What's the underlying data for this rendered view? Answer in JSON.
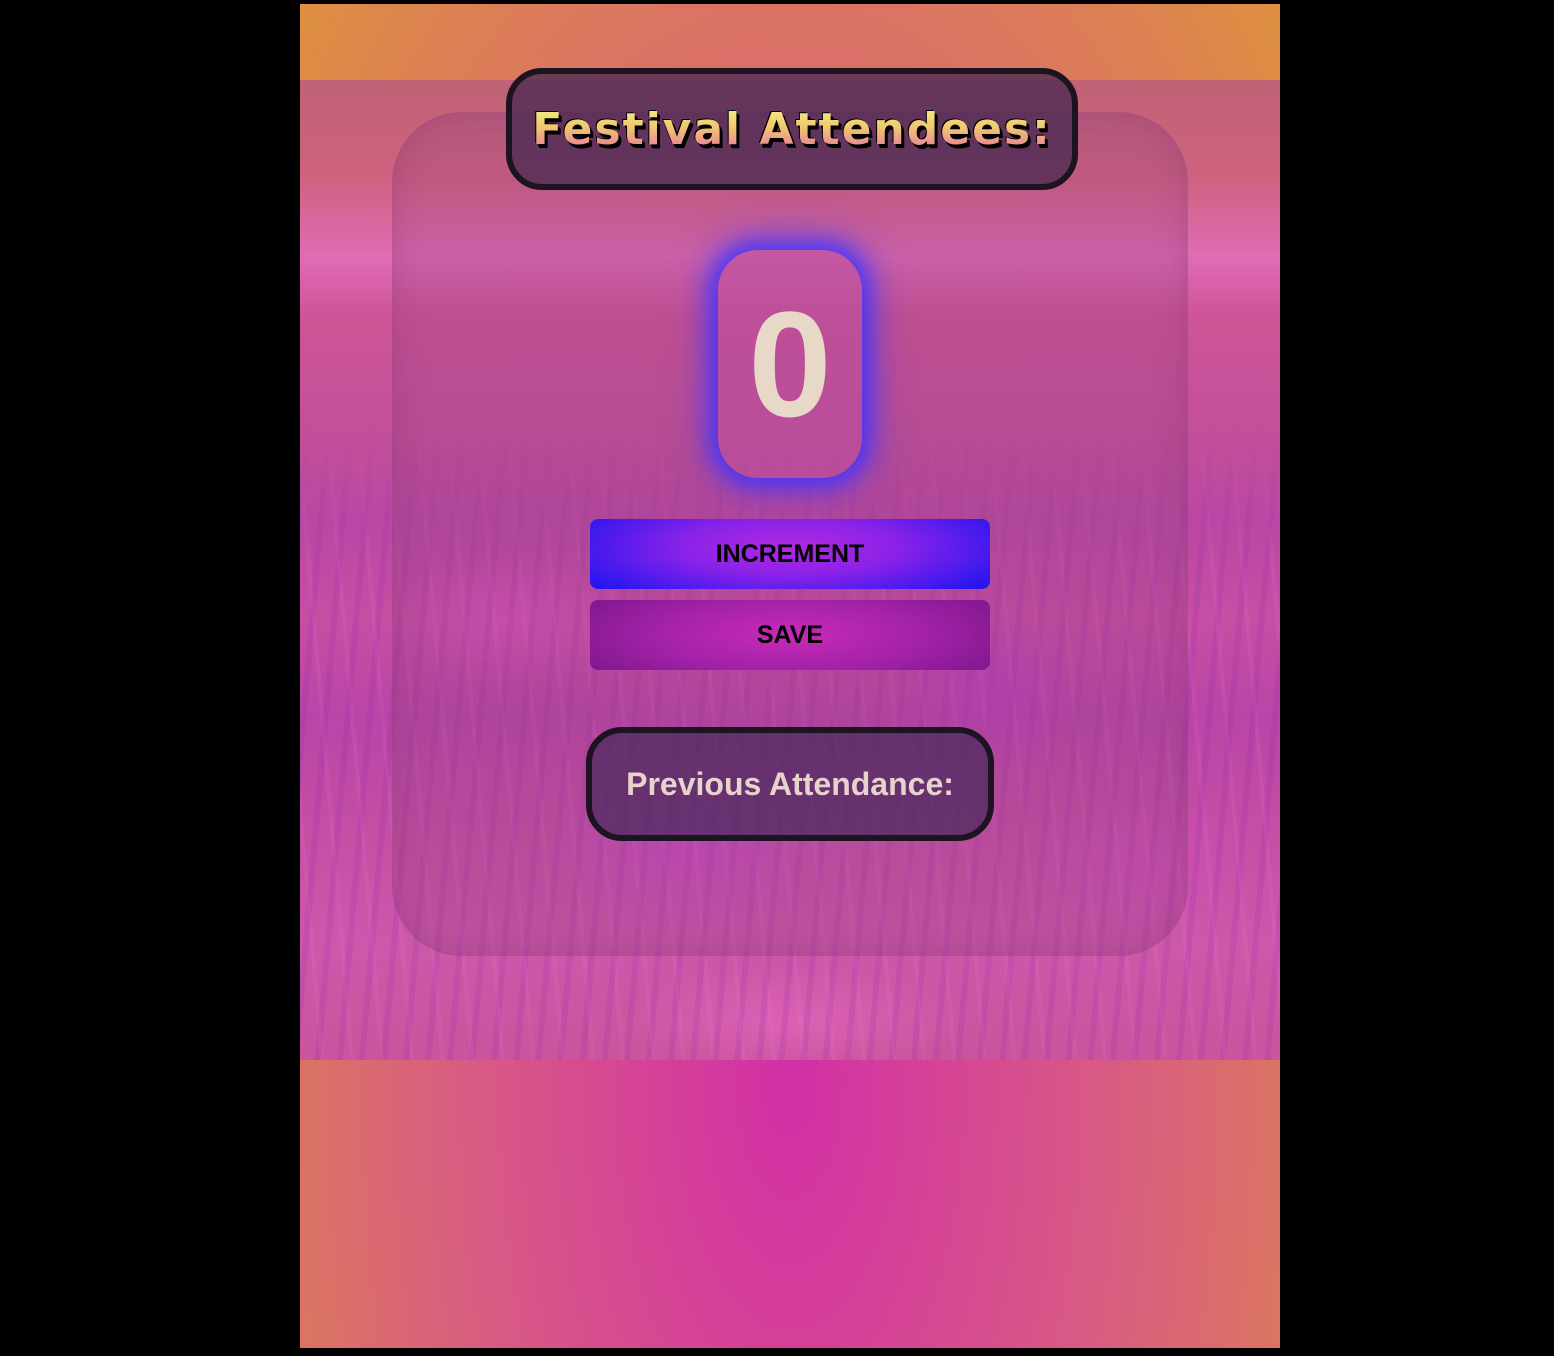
{
  "header": {
    "title": "Festival Attendees:"
  },
  "counter": {
    "value": "0"
  },
  "actions": {
    "increment_label": "INCREMENT",
    "save_label": "SAVE"
  },
  "history": {
    "label": "Previous Attendance:"
  },
  "colors": {
    "increment_button": "#8a22e8",
    "save_button": "#a322a8",
    "counter_glow": "#3c32ff",
    "counter_text": "#e7d8c8",
    "title_gradient_top": "#f5f38a",
    "title_gradient_bottom": "#e86aa6"
  }
}
